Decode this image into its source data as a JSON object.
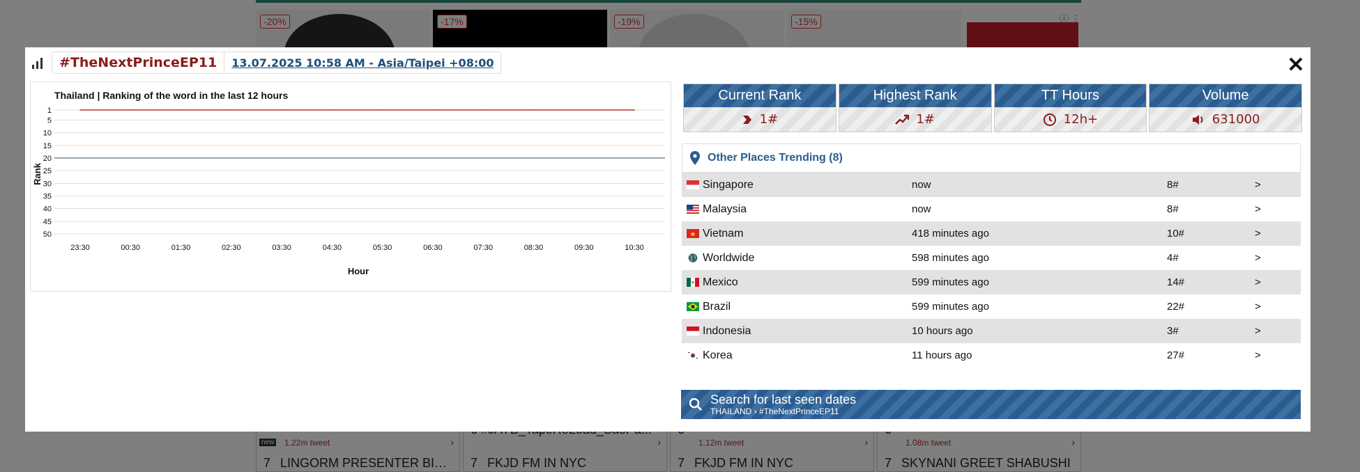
{
  "background": {
    "discounts": [
      "-20%",
      "-17%",
      "-19%",
      "-15%"
    ],
    "cards": [
      {
        "prev": "",
        "tweets": "1.22m tweet",
        "new_tag": "new",
        "rank": "7",
        "name": "LINGORM PRESENTER BITE..."
      },
      {
        "prev": "6  #JAYB_TapeReLoad_SaoPa...",
        "tweets": "",
        "new_tag": "",
        "rank": "7",
        "name": "FKJD FM IN NYC"
      },
      {
        "prev": "6",
        "tweets": "1.12m tweet",
        "new_tag": "",
        "rank": "7",
        "name": "FKJD FM IN NYC"
      },
      {
        "prev": "6",
        "tweets": "1.08m tweet",
        "new_tag": "",
        "rank": "7",
        "name": "SKYNANI GREET SHABUSHI"
      }
    ]
  },
  "header": {
    "hashtag": "#TheNextPrinceEP11",
    "timestamp": "13.07.2025 10:58 AM - Asia/Taipei +08:00",
    "close_label": "✕"
  },
  "chart_data": {
    "type": "line",
    "title": "Thailand | Ranking of the word in the last 12 hours",
    "xlabel": "Hour",
    "ylabel": "Rank",
    "x": [
      "23:30",
      "00:30",
      "01:30",
      "02:30",
      "03:30",
      "04:30",
      "05:30",
      "06:30",
      "07:30",
      "08:30",
      "09:30",
      "10:30"
    ],
    "y_ticks": [
      1,
      5,
      10,
      15,
      20,
      25,
      30,
      35,
      40,
      45,
      50
    ],
    "ylim": [
      1,
      50
    ],
    "y_inverted": true,
    "series": [
      {
        "values": [
          1,
          1,
          1,
          1,
          1,
          1,
          1,
          1,
          1,
          1,
          1,
          1
        ],
        "color": "#b03030"
      }
    ],
    "reference_line": {
      "y": 20,
      "color": "#2b4f6e"
    },
    "grid": true
  },
  "stats": [
    {
      "label": "Current Rank",
      "value": "1#",
      "icon": "chevron-right-icon"
    },
    {
      "label": "Highest Rank",
      "value": "1#",
      "icon": "trending-up-icon"
    },
    {
      "label": "TT Hours",
      "value": "12h+",
      "icon": "clock-icon"
    },
    {
      "label": "Volume",
      "value": "631000",
      "icon": "volume-icon"
    }
  ],
  "other_places": {
    "title": "Other Places Trending (8)",
    "rows": [
      {
        "name": "Singapore",
        "time": "now",
        "rank": "8#",
        "go": ">",
        "flag": "singapore-flag-icon"
      },
      {
        "name": "Malaysia",
        "time": "now",
        "rank": "8#",
        "go": ">",
        "flag": "malaysia-flag-icon"
      },
      {
        "name": "Vietnam",
        "time": "418 minutes ago",
        "rank": "10#",
        "go": ">",
        "flag": "vietnam-flag-icon"
      },
      {
        "name": "Worldwide",
        "time": "598 minutes ago",
        "rank": "4#",
        "go": ">",
        "flag": "globe-icon"
      },
      {
        "name": "Mexico",
        "time": "599 minutes ago",
        "rank": "14#",
        "go": ">",
        "flag": "mexico-flag-icon"
      },
      {
        "name": "Brazil",
        "time": "599 minutes ago",
        "rank": "22#",
        "go": ">",
        "flag": "brazil-flag-icon"
      },
      {
        "name": "Indonesia",
        "time": "10 hours ago",
        "rank": "3#",
        "go": ">",
        "flag": "indonesia-flag-icon"
      },
      {
        "name": "Korea",
        "time": "11 hours ago",
        "rank": "27#",
        "go": ">",
        "flag": "korea-flag-icon"
      }
    ]
  },
  "search": {
    "title": "Search for last seen dates",
    "subtitle": "THAILAND › #TheNextPrinceEP11"
  }
}
